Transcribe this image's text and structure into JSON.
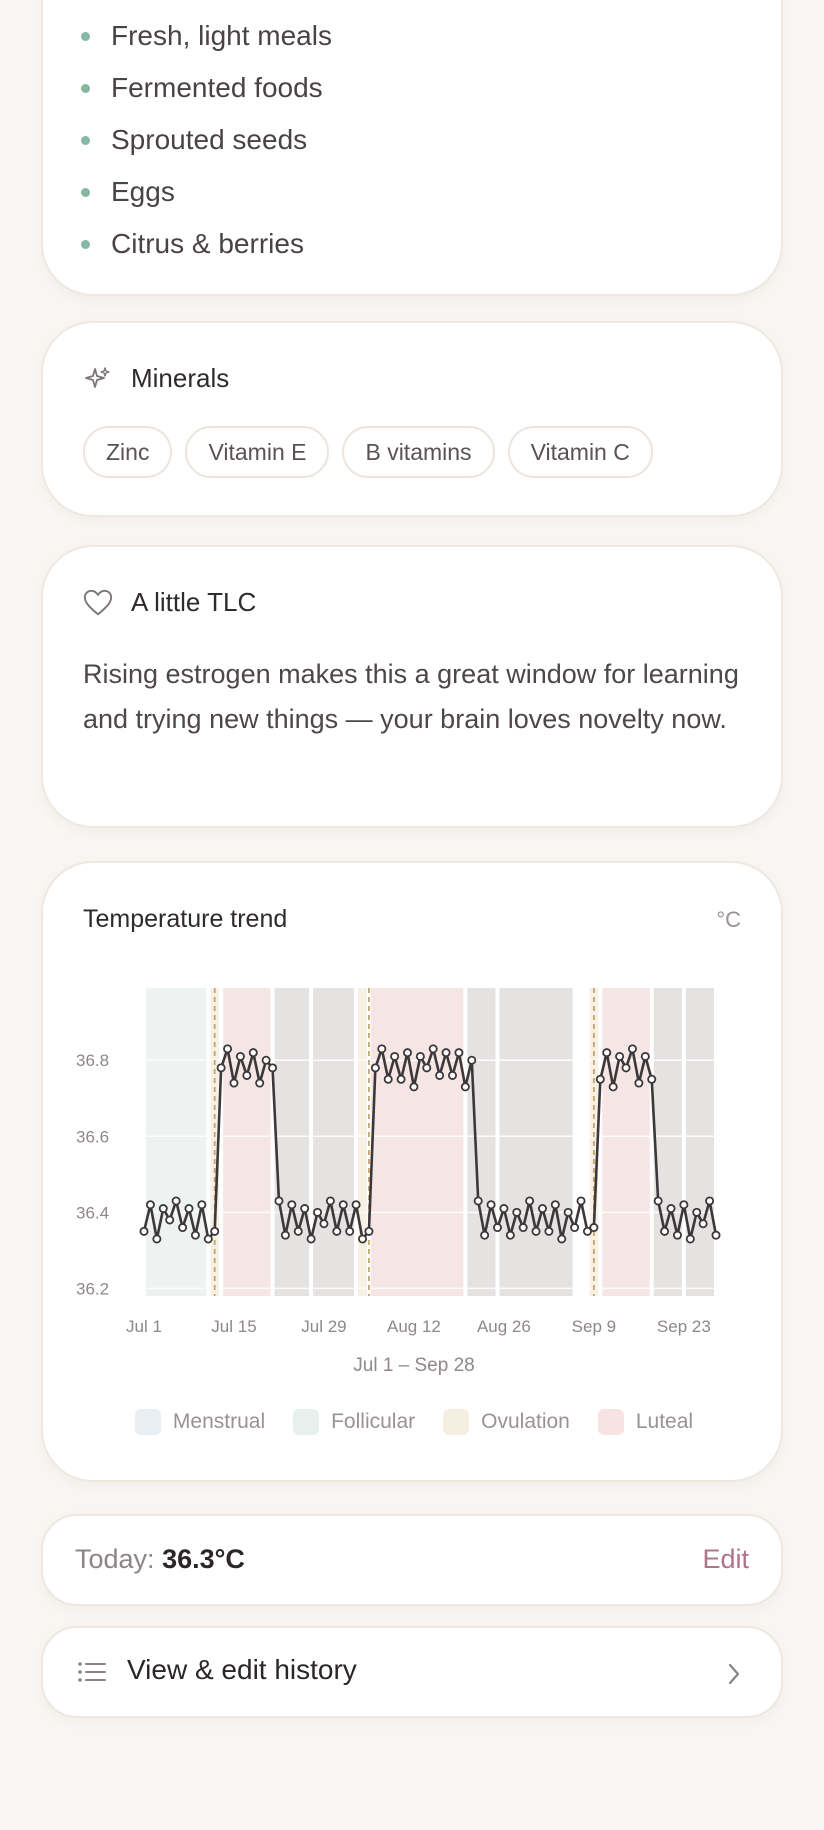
{
  "foods": {
    "items": [
      "Fresh, light meals",
      "Fermented foods",
      "Sprouted seeds",
      "Eggs",
      "Citrus & berries"
    ],
    "bullet_color": "#86b7a0"
  },
  "minerals": {
    "title": "Minerals",
    "icon": "sparkle-icon",
    "chips": [
      "Zinc",
      "Vitamin E",
      "B vitamins",
      "Vitamin C"
    ]
  },
  "tlc": {
    "title": "A little TLC",
    "icon": "heart-icon",
    "text": "Rising estrogen makes this a great window for learning and trying new things — your brain loves novelty now."
  },
  "chart": {
    "title": "Temperature trend",
    "unit": "°C",
    "range_label": "Jul 1 – Sep 28",
    "legend": [
      {
        "label": "Menstrual",
        "color": "#e9eef2"
      },
      {
        "label": "Follicular",
        "color": "#e8f0ee"
      },
      {
        "label": "Ovulation",
        "color": "#f5efe2"
      },
      {
        "label": "Luteal",
        "color": "#f7e4e2"
      }
    ]
  },
  "chart_data": {
    "type": "line",
    "title": "Temperature trend",
    "xlabel": "Jul 1 – Sep 28",
    "ylabel": "°C",
    "x_start": "Jul 1",
    "x_ticks": [
      "Jul 1",
      "Jul 15",
      "Jul 29",
      "Aug 12",
      "Aug 26",
      "Sep 9",
      "Sep 23"
    ],
    "x_tick_days": [
      0,
      14,
      28,
      42,
      56,
      70,
      84
    ],
    "y_ticks": [
      36.2,
      36.4,
      36.6,
      36.8
    ],
    "ylim": [
      36.18,
      36.99
    ],
    "xlim": [
      0,
      89
    ],
    "grid": true,
    "series": [
      {
        "values": [
          36.35,
          36.42,
          36.33,
          36.41,
          36.38,
          36.43,
          36.36,
          36.41,
          36.34,
          36.42,
          36.33,
          36.35,
          36.78,
          36.83,
          36.74,
          36.81,
          36.76,
          36.82,
          36.74,
          36.8,
          36.78,
          36.43,
          36.34,
          36.42,
          36.35,
          36.41,
          36.33,
          36.4,
          36.37,
          36.43,
          36.35,
          36.42,
          36.35,
          36.42,
          36.33,
          36.35,
          36.78,
          36.83,
          36.75,
          36.81,
          36.75,
          36.82,
          36.73,
          36.81,
          36.78,
          36.83,
          36.76,
          36.82,
          36.76,
          36.82,
          36.73,
          36.8,
          36.43,
          36.34,
          36.42,
          36.36,
          36.41,
          36.34,
          36.4,
          36.36,
          36.43,
          36.35,
          36.41,
          36.35,
          36.42,
          36.33,
          36.4,
          36.36,
          36.43,
          36.35,
          36.36,
          36.75,
          36.82,
          36.73,
          36.81,
          36.78,
          36.83,
          36.74,
          36.81,
          36.75,
          36.43,
          36.35,
          36.41,
          36.34,
          36.42,
          36.33,
          36.4,
          36.37,
          36.43,
          36.34
        ]
      }
    ],
    "phase_bands": [
      {
        "phase": "Follicular",
        "start": 0,
        "end": 10
      },
      {
        "phase": "Ovulation",
        "start": 10,
        "end": 12
      },
      {
        "phase": "Luteal",
        "start": 12,
        "end": 20
      },
      {
        "phase": "Menstrual",
        "start": 20,
        "end": 26
      },
      {
        "phase": "Menstrual",
        "start": 26,
        "end": 33
      },
      {
        "phase": "Ovulation",
        "start": 33,
        "end": 35
      },
      {
        "phase": "Luteal",
        "start": 35,
        "end": 50
      },
      {
        "phase": "Menstrual",
        "start": 50,
        "end": 55
      },
      {
        "phase": "Menstrual",
        "start": 55,
        "end": 67
      },
      {
        "phase": "Ovulation",
        "start": 69,
        "end": 71
      },
      {
        "phase": "Luteal",
        "start": 71,
        "end": 79
      },
      {
        "phase": "Menstrual",
        "start": 79,
        "end": 84
      },
      {
        "phase": "Menstrual",
        "start": 84,
        "end": 89
      }
    ],
    "ovulation_days": [
      11,
      35,
      70
    ]
  },
  "today": {
    "label": "Today:",
    "value": "36.3°C",
    "edit_label": "Edit"
  },
  "history": {
    "label": "View & edit history",
    "icon": "list-icon"
  },
  "colors": {
    "accent": "#b0738a",
    "line": "#3c3839",
    "ovulation_line": "#c9a370"
  }
}
